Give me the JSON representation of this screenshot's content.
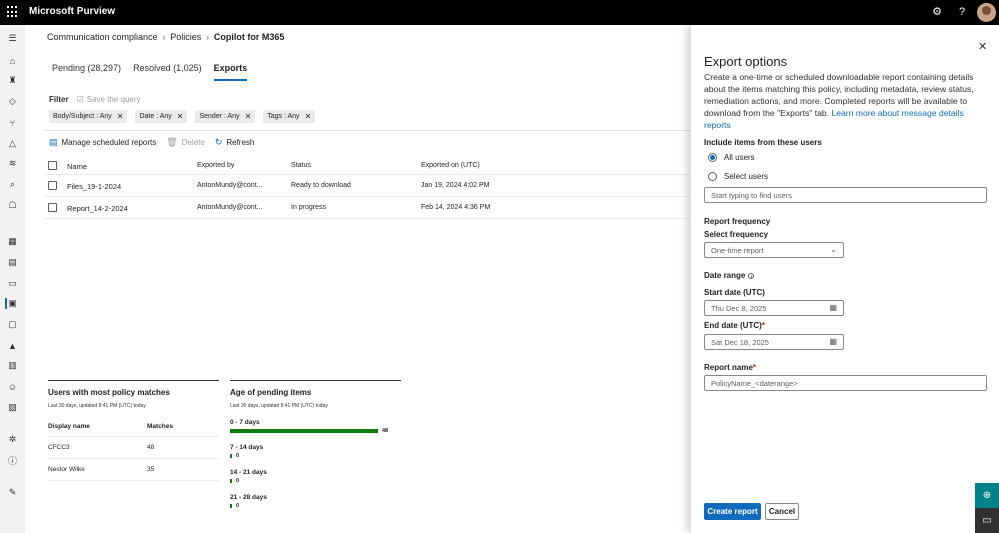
{
  "app": {
    "title": "Microsoft Purview"
  },
  "breadcrumb": [
    "Communication compliance",
    "Policies",
    "Copilot for M365"
  ],
  "tabs": [
    "Pending (28,297)",
    "Resolved (1,025)",
    "Exports"
  ],
  "filter": {
    "label": "Filter",
    "save_query": "Save the query",
    "chips": [
      "Body/Subject : Any",
      "Date : Any",
      "Sender : Any",
      "Tags : Any"
    ]
  },
  "toolbar": {
    "manage": "Manage scheduled reports",
    "delete": "Delete",
    "refresh": "Refresh"
  },
  "table": {
    "headers": [
      "Name",
      "Exported by",
      "Status",
      "Exported on (UTC)"
    ],
    "rows": [
      [
        "Files_19-1-2024",
        "AntonMundy@cont...",
        "Ready to download",
        "Jan 19, 2024 4:02 PM"
      ],
      [
        "Report_14-2-2024",
        "AntonMundy@cont...",
        "In progress",
        "Feb 14, 2024 4:36 PM"
      ]
    ]
  },
  "users_widget": {
    "title": "Users with most policy matches",
    "subtitle": "Last 30 days, updated 8:41 PM (UTC) today",
    "headers": [
      "Display name",
      "Matches"
    ],
    "rows": [
      [
        "CFCC3",
        "48"
      ],
      [
        "Nestor Wilke",
        "35"
      ]
    ]
  },
  "age_widget": {
    "title": "Age of pending items",
    "subtitle": "Last 30 days, updated 8:41 PM (UTC) today",
    "max": 48,
    "items": [
      {
        "label": "0 - 7 days",
        "value": 48
      },
      {
        "label": "7 - 14 days",
        "value": 0
      },
      {
        "label": "14 - 21 days",
        "value": 0
      },
      {
        "label": "21 - 28 days",
        "value": 0
      }
    ]
  },
  "panel": {
    "title": "Export options",
    "description": "Create a one-time or scheduled downloadable report containing details about the items matching this policy, including metadata, review status, remediation actions, and more. Completed reports will be available to download from the \"Exports\" tab.",
    "link": "Learn more about message details reports",
    "include_label": "Include items from these users",
    "all_users": "All users",
    "select_users": "Select users",
    "users_placeholder": "Start typing to find users",
    "freq_section": "Report frequency",
    "freq_label": "Select frequency",
    "freq_value": "One-time report",
    "date_range": "Date range",
    "start_label": "Start date (UTC)",
    "start_value": "Thu Dec 8, 2025",
    "end_label": "End date (UTC)",
    "end_value": "Sat Dec 18, 2025",
    "name_label": "Report name",
    "name_placeholder": "PolicyName_<daterange>",
    "create": "Create report",
    "cancel": "Cancel"
  },
  "colors": {
    "accent": "#0f6cbd",
    "teal": "#038387",
    "bar": "#107c10"
  }
}
